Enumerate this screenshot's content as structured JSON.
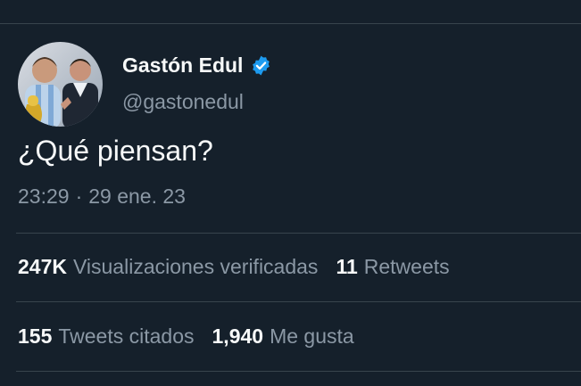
{
  "author": {
    "display_name": "Gastón Edul",
    "handle": "@gastonedul",
    "verified": true,
    "verified_color": "#1d9bf0"
  },
  "tweet": {
    "text": "¿Qué piensan?",
    "time": "23:29",
    "separator": "·",
    "date": "29 ene. 23"
  },
  "stats": {
    "views_count": "247K",
    "views_label": "Visualizaciones verificadas",
    "retweets_count": "11",
    "retweets_label": "Retweets",
    "quotes_count": "155",
    "quotes_label": "Tweets citados",
    "likes_count": "1,940",
    "likes_label": "Me gusta"
  },
  "theme": {
    "background": "#15202b",
    "text_primary": "#f7f9f9",
    "text_secondary": "#8b98a5",
    "divider": "#38444d"
  }
}
